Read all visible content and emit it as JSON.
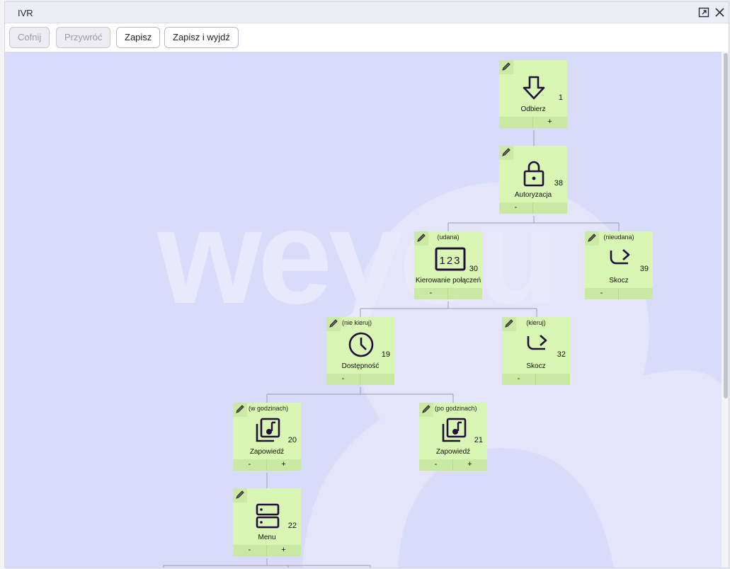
{
  "window": {
    "title": "IVR"
  },
  "toolbar": {
    "undo_label": "Cofnij",
    "redo_label": "Przywróć",
    "save_label": "Zapisz",
    "save_exit_label": "Zapisz i wyjdź"
  },
  "watermark": {
    "text": "weyou"
  },
  "nodes": [
    {
      "id": "n1",
      "condition": "",
      "icon": "arrow-down-icon",
      "number": "1",
      "label": "Odbierz",
      "left": "",
      "right": "+"
    },
    {
      "id": "n38",
      "condition": "",
      "icon": "lock-icon",
      "number": "38",
      "label": "Autoryzacja",
      "left": "-",
      "right": ""
    },
    {
      "id": "n30",
      "condition": "(udana)",
      "icon": "numpad-icon",
      "number": "30",
      "label": "Kierowanie połączeń",
      "left": "-",
      "right": ""
    },
    {
      "id": "n39",
      "condition": "(nieudana)",
      "icon": "redirect-icon",
      "number": "39",
      "label": "Skocz",
      "left": "-",
      "right": ""
    },
    {
      "id": "n19",
      "condition": "(nie kieruj)",
      "icon": "clock-icon",
      "number": "19",
      "label": "Dostępność",
      "left": "-",
      "right": ""
    },
    {
      "id": "n32",
      "condition": "(kieruj)",
      "icon": "redirect-icon",
      "number": "32",
      "label": "Skocz",
      "left": "-",
      "right": ""
    },
    {
      "id": "n20",
      "condition": "(w godzinach)",
      "icon": "music-icon",
      "number": "20",
      "label": "Zapowiedź",
      "left": "-",
      "right": "+"
    },
    {
      "id": "n21",
      "condition": "(po godzinach)",
      "icon": "music-icon",
      "number": "21",
      "label": "Zapowiedź",
      "left": "-",
      "right": "+"
    },
    {
      "id": "n22",
      "condition": "",
      "icon": "menu-icon",
      "number": "22",
      "label": "Menu",
      "left": "-",
      "right": "+"
    }
  ],
  "colors": {
    "canvas": "#d9dbfa",
    "node": "#d9f5b3",
    "node_footer": "#c9e9a3",
    "accent": "#1f0f3a"
  }
}
